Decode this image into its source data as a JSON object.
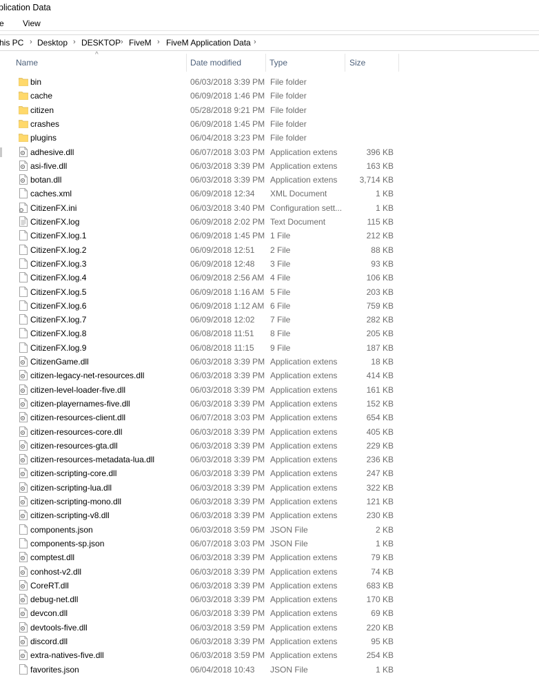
{
  "window": {
    "title": "plication Data"
  },
  "menu": {
    "items": [
      "e",
      "View"
    ]
  },
  "breadcrumb": [
    "his PC",
    "Desktop",
    "DESKTOP",
    "FiveM",
    "FiveM Application Data"
  ],
  "columns": {
    "name": "Name",
    "date": "Date modified",
    "type": "Type",
    "size": "Size"
  },
  "files": [
    {
      "name": "bin",
      "date": "06/03/2018 3:39 PM",
      "type": "File folder",
      "size": "",
      "icon": "folder-icon"
    },
    {
      "name": "cache",
      "date": "06/09/2018 1:46 PM",
      "type": "File folder",
      "size": "",
      "icon": "folder-icon"
    },
    {
      "name": "citizen",
      "date": "05/28/2018 9:21 PM",
      "type": "File folder",
      "size": "",
      "icon": "folder-icon"
    },
    {
      "name": "crashes",
      "date": "06/09/2018 1:45 PM",
      "type": "File folder",
      "size": "",
      "icon": "folder-icon"
    },
    {
      "name": "plugins",
      "date": "06/04/2018 3:23 PM",
      "type": "File folder",
      "size": "",
      "icon": "folder-icon"
    },
    {
      "name": "adhesive.dll",
      "date": "06/07/2018 3:03 PM",
      "type": "Application extens",
      "size": "396 KB",
      "icon": "dll-icon"
    },
    {
      "name": "asi-five.dll",
      "date": "06/03/2018 3:39 PM",
      "type": "Application extens",
      "size": "163 KB",
      "icon": "dll-icon"
    },
    {
      "name": "botan.dll",
      "date": "06/03/2018 3:39 PM",
      "type": "Application extens",
      "size": "3,714 KB",
      "icon": "dll-icon"
    },
    {
      "name": "caches.xml",
      "date": "06/09/2018 12:34",
      "type": "XML Document",
      "size": "1 KB",
      "icon": "file-icon"
    },
    {
      "name": "CitizenFX.ini",
      "date": "06/03/2018 3:40 PM",
      "type": "Configuration sett...",
      "size": "1 KB",
      "icon": "ini-icon"
    },
    {
      "name": "CitizenFX.log",
      "date": "06/09/2018 2:02 PM",
      "type": "Text Document",
      "size": "115 KB",
      "icon": "text-file-icon"
    },
    {
      "name": "CitizenFX.log.1",
      "date": "06/09/2018 1:45 PM",
      "type": "1 File",
      "size": "212 KB",
      "icon": "file-icon"
    },
    {
      "name": "CitizenFX.log.2",
      "date": "06/09/2018 12:51",
      "type": "2 File",
      "size": "88 KB",
      "icon": "file-icon"
    },
    {
      "name": "CitizenFX.log.3",
      "date": "06/09/2018 12:48",
      "type": "3 File",
      "size": "93 KB",
      "icon": "file-icon"
    },
    {
      "name": "CitizenFX.log.4",
      "date": "06/09/2018 2:56 AM",
      "type": "4 File",
      "size": "106 KB",
      "icon": "file-icon"
    },
    {
      "name": "CitizenFX.log.5",
      "date": "06/09/2018 1:16 AM",
      "type": "5 File",
      "size": "203 KB",
      "icon": "file-icon"
    },
    {
      "name": "CitizenFX.log.6",
      "date": "06/09/2018 1:12 AM",
      "type": "6 File",
      "size": "759 KB",
      "icon": "file-icon"
    },
    {
      "name": "CitizenFX.log.7",
      "date": "06/09/2018 12:02",
      "type": "7 File",
      "size": "282 KB",
      "icon": "file-icon"
    },
    {
      "name": "CitizenFX.log.8",
      "date": "06/08/2018 11:51",
      "type": "8 File",
      "size": "205 KB",
      "icon": "file-icon"
    },
    {
      "name": "CitizenFX.log.9",
      "date": "06/08/2018 11:15",
      "type": "9 File",
      "size": "187 KB",
      "icon": "file-icon"
    },
    {
      "name": "CitizenGame.dll",
      "date": "06/03/2018 3:39 PM",
      "type": "Application extens",
      "size": "18 KB",
      "icon": "dll-icon"
    },
    {
      "name": "citizen-legacy-net-resources.dll",
      "date": "06/03/2018 3:39 PM",
      "type": "Application extens",
      "size": "414 KB",
      "icon": "dll-icon"
    },
    {
      "name": "citizen-level-loader-five.dll",
      "date": "06/03/2018 3:39 PM",
      "type": "Application extens",
      "size": "161 KB",
      "icon": "dll-icon"
    },
    {
      "name": "citizen-playernames-five.dll",
      "date": "06/03/2018 3:39 PM",
      "type": "Application extens",
      "size": "152 KB",
      "icon": "dll-icon"
    },
    {
      "name": "citizen-resources-client.dll",
      "date": "06/07/2018 3:03 PM",
      "type": "Application extens",
      "size": "654 KB",
      "icon": "dll-icon"
    },
    {
      "name": "citizen-resources-core.dll",
      "date": "06/03/2018 3:39 PM",
      "type": "Application extens",
      "size": "405 KB",
      "icon": "dll-icon"
    },
    {
      "name": "citizen-resources-gta.dll",
      "date": "06/03/2018 3:39 PM",
      "type": "Application extens",
      "size": "229 KB",
      "icon": "dll-icon"
    },
    {
      "name": "citizen-resources-metadata-lua.dll",
      "date": "06/03/2018 3:39 PM",
      "type": "Application extens",
      "size": "236 KB",
      "icon": "dll-icon"
    },
    {
      "name": "citizen-scripting-core.dll",
      "date": "06/03/2018 3:39 PM",
      "type": "Application extens",
      "size": "247 KB",
      "icon": "dll-icon"
    },
    {
      "name": "citizen-scripting-lua.dll",
      "date": "06/03/2018 3:39 PM",
      "type": "Application extens",
      "size": "322 KB",
      "icon": "dll-icon"
    },
    {
      "name": "citizen-scripting-mono.dll",
      "date": "06/03/2018 3:39 PM",
      "type": "Application extens",
      "size": "121 KB",
      "icon": "dll-icon"
    },
    {
      "name": "citizen-scripting-v8.dll",
      "date": "06/03/2018 3:39 PM",
      "type": "Application extens",
      "size": "230 KB",
      "icon": "dll-icon"
    },
    {
      "name": "components.json",
      "date": "06/03/2018 3:59 PM",
      "type": "JSON File",
      "size": "2 KB",
      "icon": "file-icon"
    },
    {
      "name": "components-sp.json",
      "date": "06/07/2018 3:03 PM",
      "type": "JSON File",
      "size": "1 KB",
      "icon": "file-icon"
    },
    {
      "name": "comptest.dll",
      "date": "06/03/2018 3:39 PM",
      "type": "Application extens",
      "size": "79 KB",
      "icon": "dll-icon"
    },
    {
      "name": "conhost-v2.dll",
      "date": "06/03/2018 3:39 PM",
      "type": "Application extens",
      "size": "74 KB",
      "icon": "dll-icon"
    },
    {
      "name": "CoreRT.dll",
      "date": "06/03/2018 3:39 PM",
      "type": "Application extens",
      "size": "683 KB",
      "icon": "dll-icon"
    },
    {
      "name": "debug-net.dll",
      "date": "06/03/2018 3:39 PM",
      "type": "Application extens",
      "size": "170 KB",
      "icon": "dll-icon"
    },
    {
      "name": "devcon.dll",
      "date": "06/03/2018 3:39 PM",
      "type": "Application extens",
      "size": "69 KB",
      "icon": "dll-icon"
    },
    {
      "name": "devtools-five.dll",
      "date": "06/03/2018 3:59 PM",
      "type": "Application extens",
      "size": "220 KB",
      "icon": "dll-icon"
    },
    {
      "name": "discord.dll",
      "date": "06/03/2018 3:39 PM",
      "type": "Application extens",
      "size": "95 KB",
      "icon": "dll-icon"
    },
    {
      "name": "extra-natives-five.dll",
      "date": "06/03/2018 3:59 PM",
      "type": "Application extens",
      "size": "254 KB",
      "icon": "dll-icon"
    },
    {
      "name": "favorites.json",
      "date": "06/04/2018 10:43",
      "type": "JSON File",
      "size": "1 KB",
      "icon": "file-icon"
    }
  ]
}
